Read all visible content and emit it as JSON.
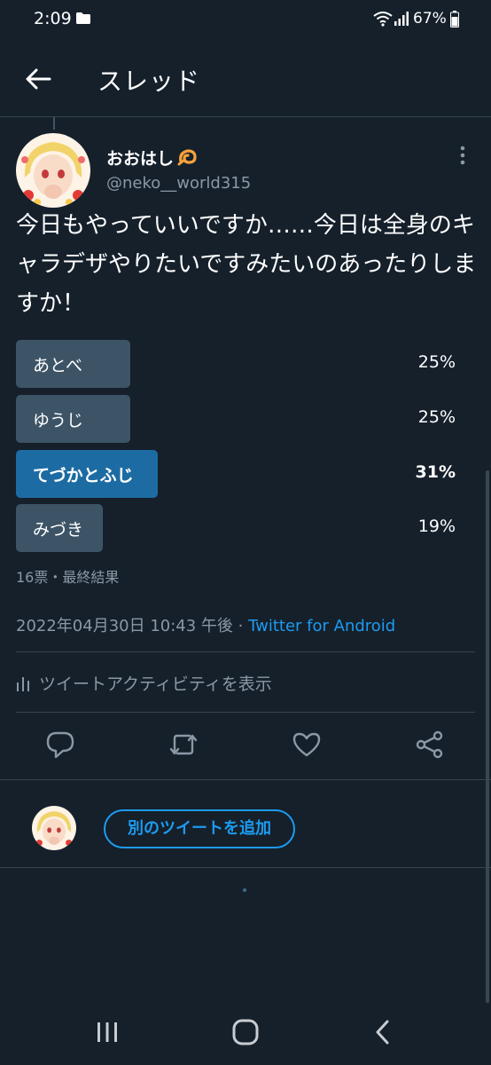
{
  "status_bar": {
    "time": "2:09",
    "battery": "67%",
    "icons": [
      "folder-icon",
      "wifi-icon",
      "signal-icon",
      "battery-icon"
    ]
  },
  "header": {
    "title": "スレッド",
    "back_icon": "arrow-left-icon"
  },
  "tweet": {
    "author_name": "おおはし",
    "author_emoji": "💫",
    "author_handle": "@neko__world315",
    "text": "今日もやっていいですか……今日は全身のキャラデザやりたいですみたいのあったりしますか！",
    "poll": {
      "options": [
        {
          "label": "あとべ",
          "percent": "25%",
          "fraction": 0.25,
          "winner": false
        },
        {
          "label": "ゆうじ",
          "percent": "25%",
          "fraction": 0.25,
          "winner": false
        },
        {
          "label": "てづかとふじ",
          "percent": "31%",
          "fraction": 0.31,
          "winner": true
        },
        {
          "label": "みづき",
          "percent": "19%",
          "fraction": 0.19,
          "winner": false
        }
      ],
      "meta": "16票・最終結果"
    },
    "timestamp": "2022年04月30日 10:43 午後 · ",
    "source": "Twitter for Android",
    "activity_label": "ツイートアクティビティを表示",
    "actions": [
      "reply-icon",
      "retweet-icon",
      "like-icon",
      "share-icon"
    ]
  },
  "reply": {
    "button_label": "別のツイートを追加"
  },
  "colors": {
    "background": "#15202b",
    "accent": "#1d9bf0",
    "poll_bar": "#3d5466",
    "poll_winner": "#1d6ba3",
    "muted_text": "#8b98a5"
  },
  "nav_bar": [
    "recents-icon",
    "home-icon",
    "back-icon"
  ]
}
